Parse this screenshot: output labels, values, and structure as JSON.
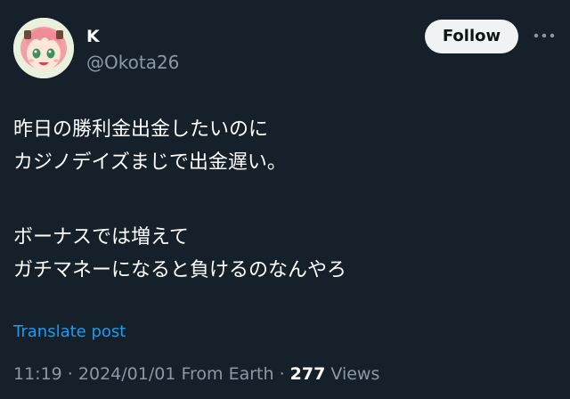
{
  "author": {
    "name": "K",
    "handle": "@Okota26",
    "avatar_icon": "anime-girl-avatar"
  },
  "follow_label": "Follow",
  "more_icon": "more-horizontal-icon",
  "tweet": {
    "lines": [
      "昨日の勝利金出金したいのに",
      "カジノデイズまじで出金遅い。",
      "ボーナスでは増えて",
      "ガチマネーになると負けるのなんやろ"
    ]
  },
  "translate_label": "Translate post",
  "meta": {
    "time": "11:19",
    "sep1": " · ",
    "date": "2024/01/01",
    "location": "From Earth",
    "sep2": " · ",
    "views_count": "277",
    "views_label": "Views"
  },
  "colors": {
    "background": "#15202b",
    "text": "#ffffff",
    "secondary": "#8b98a5",
    "link": "#1d9bf0",
    "button_bg": "#eff3f4"
  }
}
